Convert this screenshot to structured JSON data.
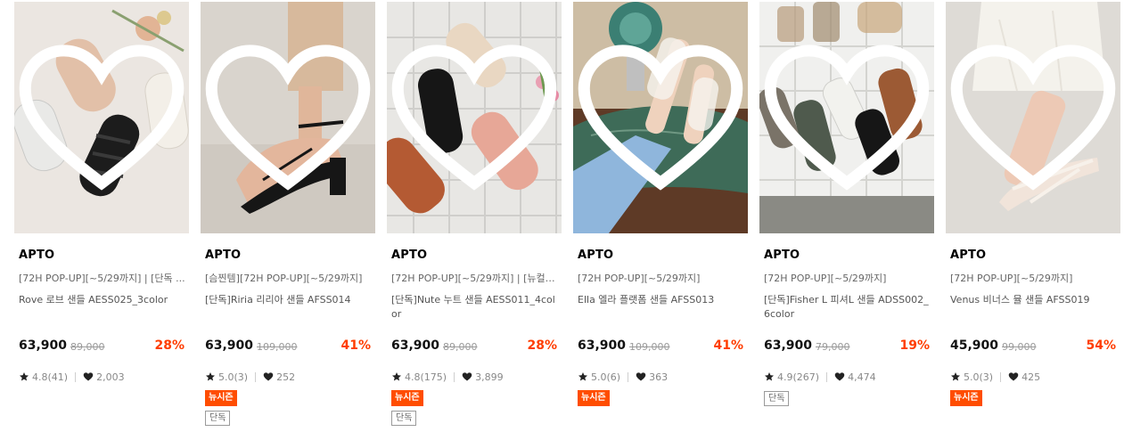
{
  "products": [
    {
      "brand": "APTO",
      "promo": "[72H POP-UP][~5/29까지] | [단독 ...",
      "name": "Rove 로브 샌들 AESS025_3color",
      "price": "63,900",
      "original_price": "89,000",
      "discount": "28%",
      "rating": "4.8(41)",
      "likes": "2,003",
      "badges": [],
      "image_colors": [
        "#ebe6e1",
        "#cfc3b6"
      ]
    },
    {
      "brand": "APTO",
      "promo": "[슴찐템][72H POP-UP][~5/29까지]",
      "name": "[단독]Riria 리리아 샌들 AFSS014",
      "price": "63,900",
      "original_price": "109,000",
      "discount": "41%",
      "rating": "5.0(3)",
      "likes": "252",
      "badges": [
        "뉴시즌",
        "단독"
      ],
      "image_colors": [
        "#d8d3cc",
        "#c7a588"
      ]
    },
    {
      "brand": "APTO",
      "promo": "[72H POP-UP][~5/29까지] | [뉴컬러...",
      "name": "[단독]Nute 누트 샌들 AESS011_4color",
      "price": "63,900",
      "original_price": "89,000",
      "discount": "28%",
      "rating": "4.8(175)",
      "likes": "3,899",
      "badges": [
        "뉴시즌",
        "단독"
      ],
      "image_colors": [
        "#e7e6e3",
        "#c9c8c4"
      ]
    },
    {
      "brand": "APTO",
      "promo": "[72H POP-UP][~5/29까지]",
      "name": "Ella 엘라 플랫폼 샌들 AFSS013",
      "price": "63,900",
      "original_price": "109,000",
      "discount": "41%",
      "rating": "5.0(6)",
      "likes": "363",
      "badges": [
        "뉴시즌"
      ],
      "image_colors": [
        "#c8b69a",
        "#3f6b57"
      ]
    },
    {
      "brand": "APTO",
      "promo": "[72H POP-UP][~5/29까지]",
      "name": "[단독]Fisher L 피셔L 샌들 ADSS002_6color",
      "price": "63,900",
      "original_price": "79,000",
      "discount": "19%",
      "rating": "4.9(267)",
      "likes": "4,474",
      "badges": [
        "단독"
      ],
      "image_colors": [
        "#f1f1ef",
        "#b9b6ae"
      ]
    },
    {
      "brand": "APTO",
      "promo": "[72H POP-UP][~5/29까지]",
      "name": "Venus 비너스 뮬 샌들 AFSS019",
      "price": "45,900",
      "original_price": "99,000",
      "discount": "54%",
      "rating": "5.0(3)",
      "likes": "425",
      "badges": [
        "뉴시즌"
      ],
      "image_colors": [
        "#dedbd6",
        "#e9c8b6"
      ]
    }
  ],
  "icons": {
    "wishlist": "heart-outline-icon",
    "rating": "star-icon",
    "likes": "heart-filled-icon"
  },
  "colors": {
    "discount": "#ff3d00",
    "new_season_badge": "#ff4d00"
  }
}
